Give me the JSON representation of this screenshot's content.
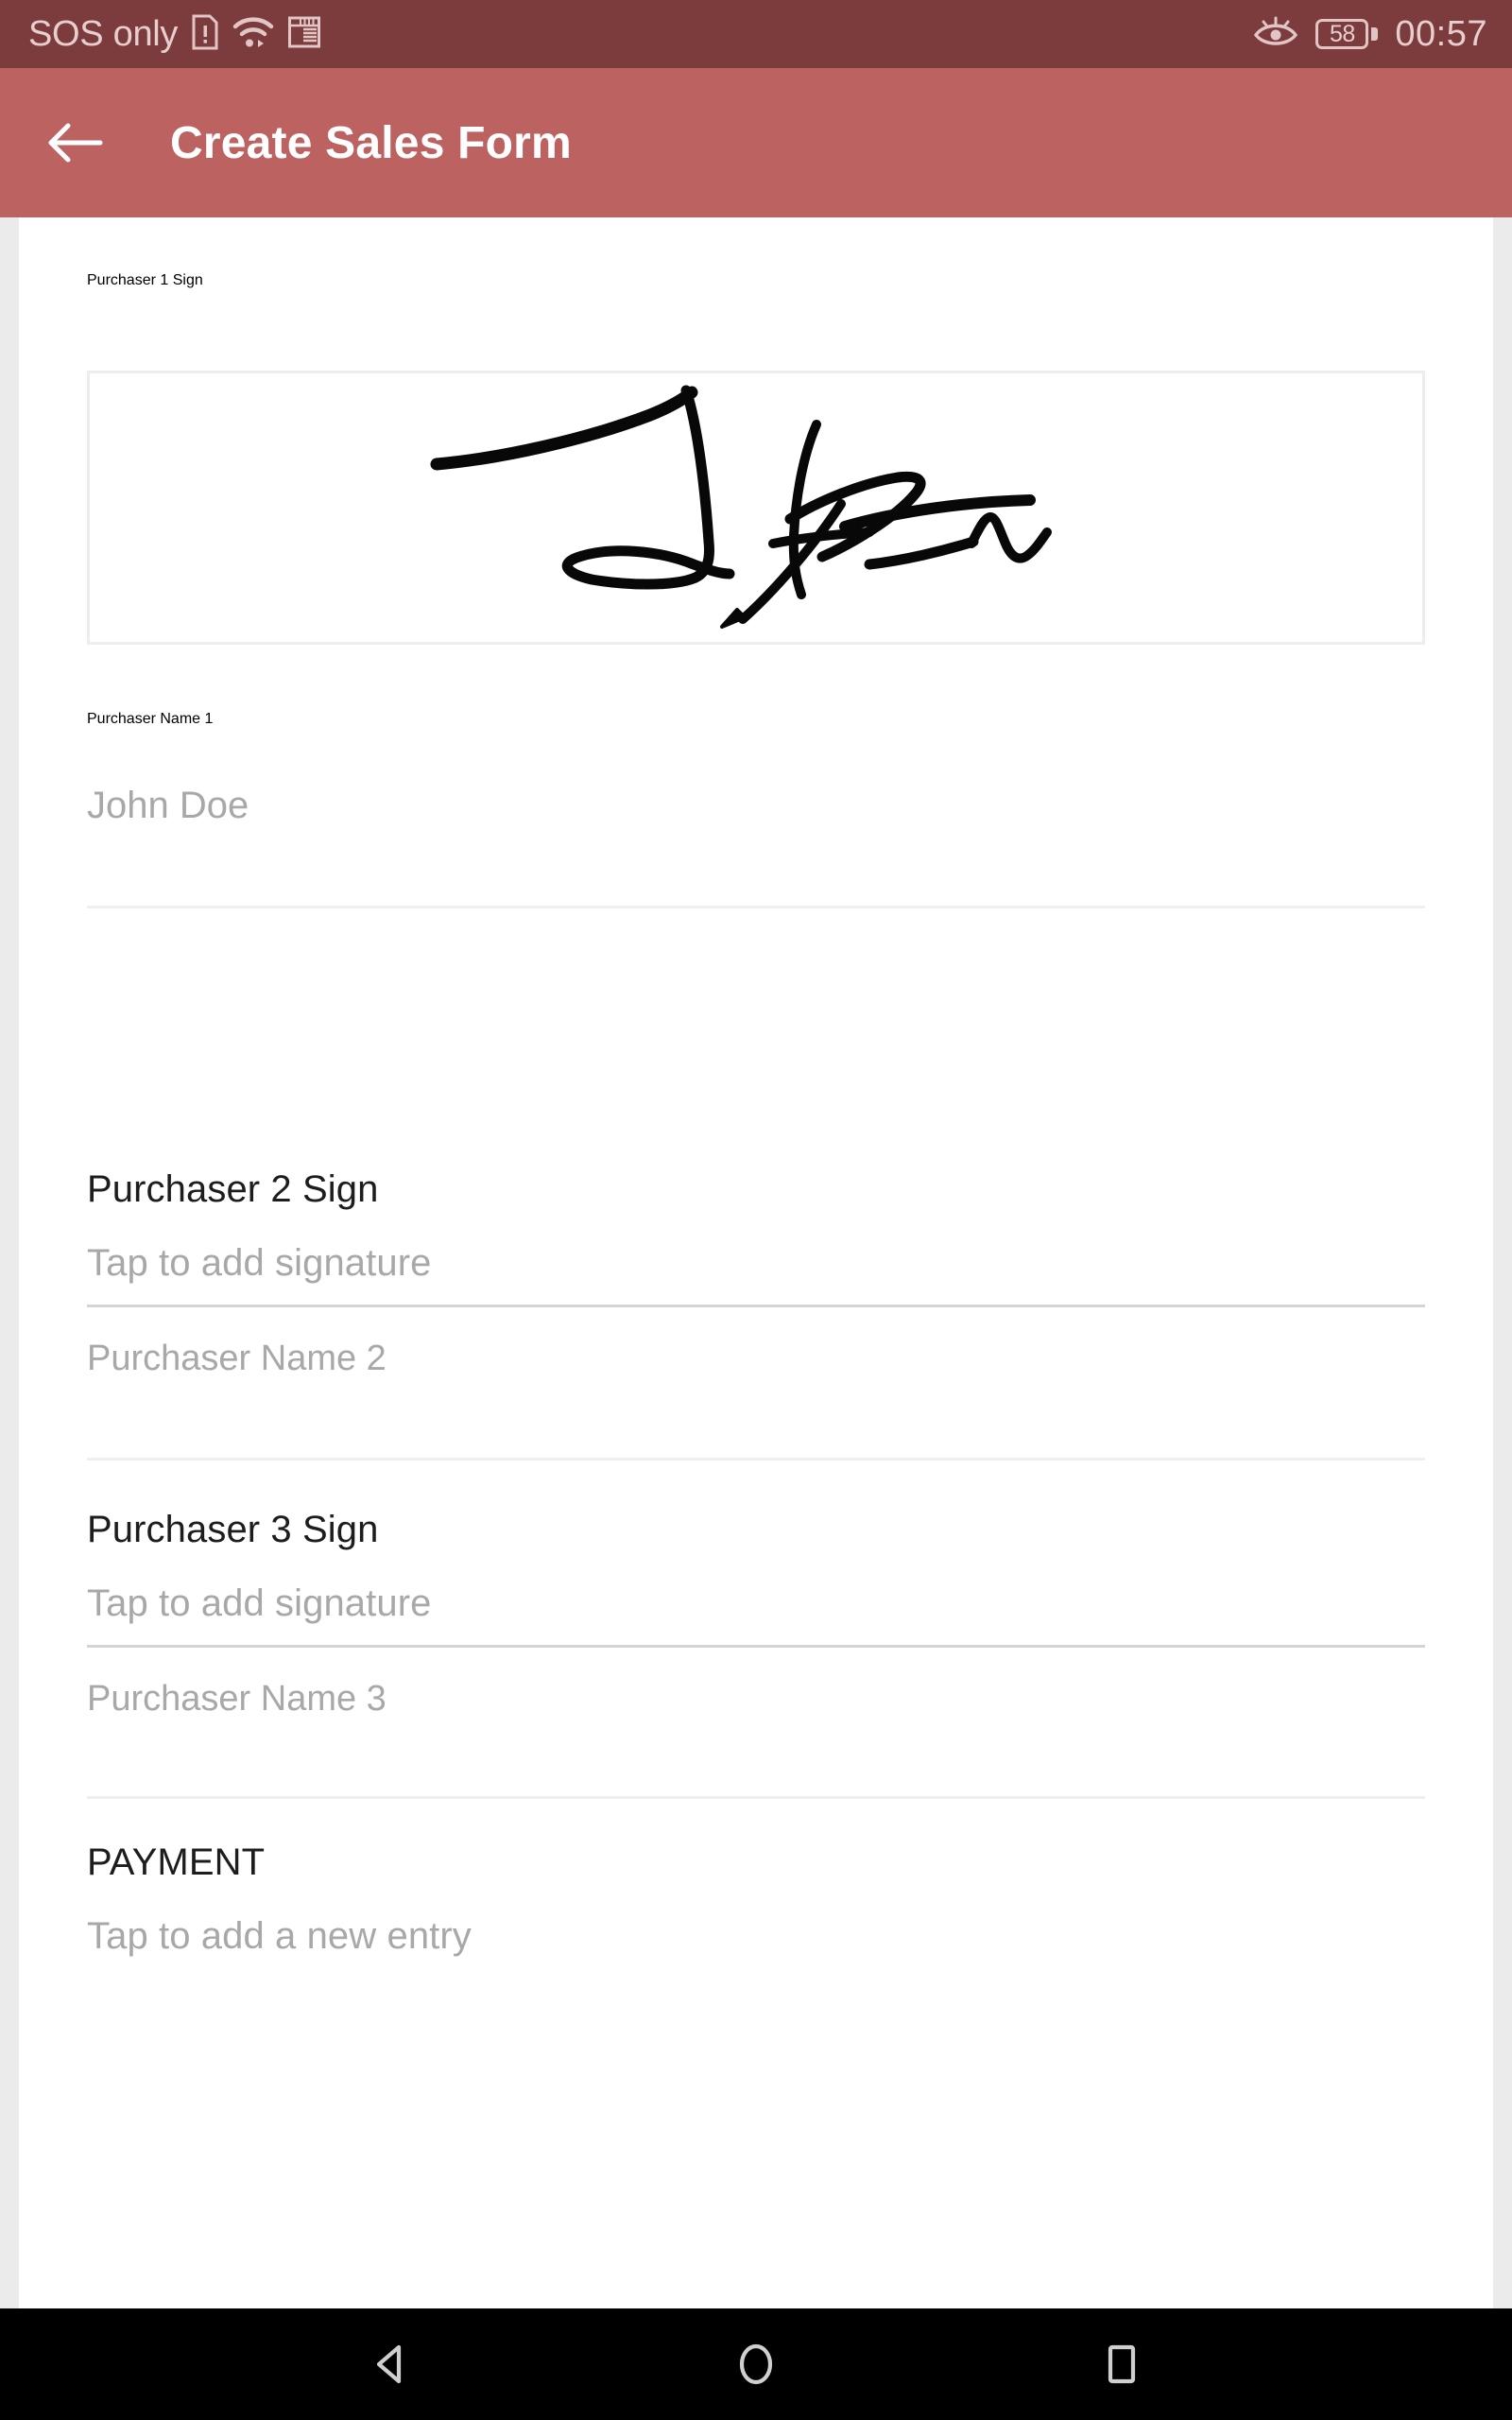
{
  "status_bar": {
    "carrier": "SOS only",
    "battery_percent": "58",
    "time": "00:57",
    "icons": [
      "sim-alert-icon",
      "wifi-icon",
      "sd-card-icon",
      "eye-icon",
      "battery-icon"
    ]
  },
  "app_bar": {
    "title": "Create Sales Form",
    "back_icon": "back-arrow-icon"
  },
  "form": {
    "purchaser1": {
      "section_title": "Purchaser 1 Sign",
      "signature_state": "signed",
      "name_label": "Purchaser Name 1",
      "name_value": "John Doe"
    },
    "purchaser2": {
      "section_title": "Purchaser 2 Sign",
      "signature_placeholder": "Tap to add signature",
      "name_label": "Purchaser Name 2",
      "name_value": ""
    },
    "purchaser3": {
      "section_title": "Purchaser 3 Sign",
      "signature_placeholder": "Tap to add signature",
      "name_label": "Purchaser Name 3",
      "name_value": ""
    },
    "payment": {
      "section_title": "PAYMENT",
      "add_entry_placeholder": "Tap to add a new entry"
    }
  },
  "nav_bar": {
    "back": "nav-back-icon",
    "home": "nav-home-icon",
    "recents": "nav-recents-icon"
  },
  "colors": {
    "status_bar": "#7c3b3c",
    "app_bar": "#bc6362",
    "card": "#ffffff",
    "page_bg": "#ebebeb",
    "text_primary": "#1d1d1d",
    "text_muted": "#a8a8a8",
    "divider": "#d4d4d4",
    "nav_bar": "#000000"
  }
}
